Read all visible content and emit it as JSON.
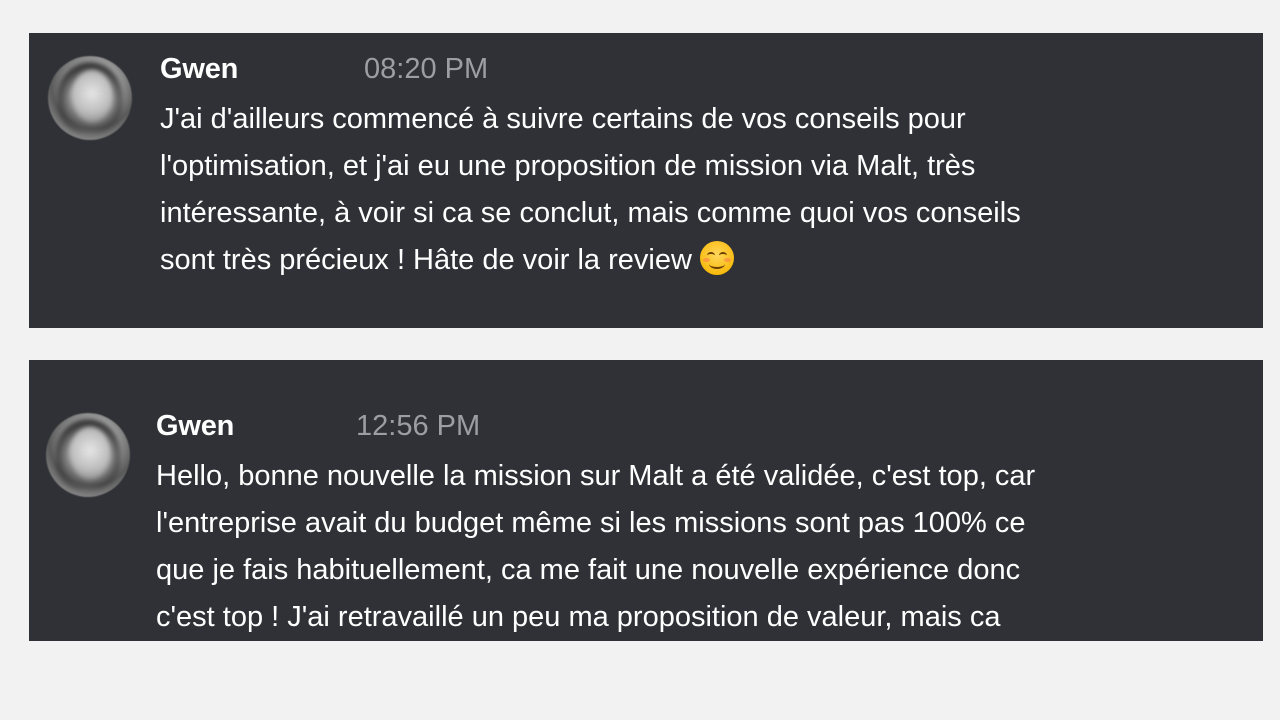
{
  "messages": [
    {
      "author": "Gwen",
      "time": "08:20 PM",
      "lines": [
        "J'ai d'ailleurs commencé à suivre certains de vos conseils pour",
        "l'optimisation, et j'ai eu une proposition de mission via Malt, très",
        "intéressante, à voir si ca se conclut, mais comme quoi vos conseils",
        "sont très précieux ! Hâte de voir la review"
      ],
      "emoji": "smiling-face-icon"
    },
    {
      "author": "Gwen",
      "time": "12:56 PM",
      "lines": [
        "Hello, bonne nouvelle la mission sur Malt a été validée, c'est top, car",
        "l'entreprise avait du budget même si les missions sont pas 100% ce",
        "que je fais habituellement, ca me fait une nouvelle expérience donc",
        "c'est top ! J'ai retravaillé un peu ma proposition de valeur, mais ca"
      ]
    }
  ],
  "colors": {
    "page_bg": "#f1f2f1",
    "card_bg": "#2f3136",
    "text": "#ffffff",
    "timestamp": "#9c9ea3"
  }
}
